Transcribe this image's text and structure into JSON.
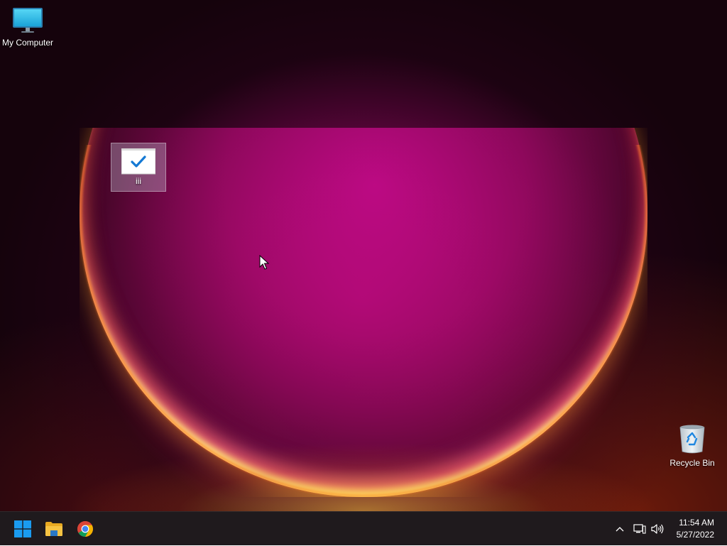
{
  "desktop": {
    "icons": [
      {
        "label": "My Computer",
        "icon": "monitor-icon"
      },
      {
        "label": "iii",
        "icon": "checkmark-window-icon",
        "selected": true
      },
      {
        "label": "Recycle Bin",
        "icon": "recycle-bin-icon"
      }
    ]
  },
  "taskbar": {
    "apps": [
      {
        "name": "Start",
        "icon": "windows-logo-icon"
      },
      {
        "name": "File Explorer",
        "icon": "folder-icon"
      },
      {
        "name": "Google Chrome",
        "icon": "chrome-icon"
      }
    ],
    "tray": {
      "chevron": "^",
      "network_icon": "network-icon",
      "volume_icon": "volume-icon"
    },
    "clock": {
      "time": "11:54 AM",
      "date": "5/27/2022"
    }
  },
  "colors": {
    "taskbar_bg": "#1f1a1d",
    "windows_blue": "#1a9bf0",
    "folder_yellow": "#f6c343"
  }
}
